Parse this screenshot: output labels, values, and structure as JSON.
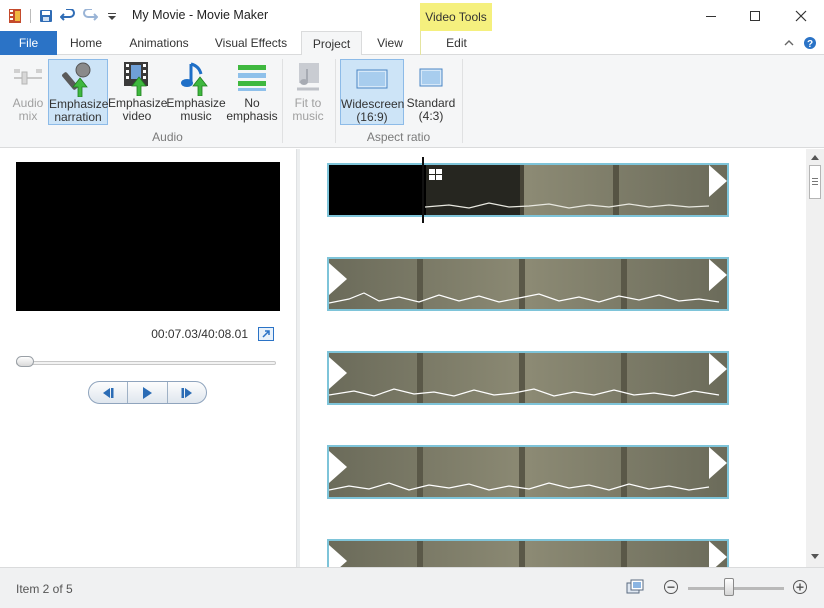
{
  "window": {
    "title": "My Movie - Movie Maker",
    "tool_tab_header": "Video Tools"
  },
  "tabs": {
    "file": "File",
    "home": "Home",
    "animations": "Animations",
    "visual_effects": "Visual Effects",
    "project": "Project",
    "view": "View",
    "edit": "Edit"
  },
  "ribbon": {
    "audio_mix_1": "Audio",
    "audio_mix_2": "mix",
    "emph_narration_1": "Emphasize",
    "emph_narration_2": "narration",
    "emph_video_1": "Emphasize",
    "emph_video_2": "video",
    "emph_music_1": "Emphasize",
    "emph_music_2": "music",
    "no_emph_1": "No",
    "no_emph_2": "emphasis",
    "fit_music_1": "Fit to",
    "fit_music_2": "music",
    "widescreen_1": "Widescreen",
    "widescreen_2": "(16:9)",
    "standard_1": "Standard",
    "standard_2": "(4:3)",
    "group_audio": "Audio",
    "group_aspect": "Aspect ratio"
  },
  "preview": {
    "timecode": "00:07.03/40:08.01",
    "seek_progress": 0.0
  },
  "status": {
    "item_text": "Item 2 of 5",
    "zoom_level": 0.42
  },
  "colors": {
    "accent": "#2b73c6",
    "tool_tab": "#f5f07e",
    "clip_border": "#7ec4d9",
    "selected_button": "#cde4f7"
  }
}
